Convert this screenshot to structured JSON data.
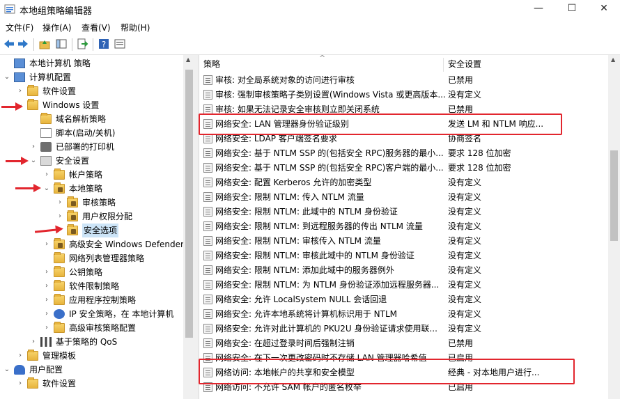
{
  "window": {
    "title": "本地组策略编辑器",
    "minimize": "—",
    "maximize": "☐",
    "close": "✕"
  },
  "menu": [
    "文件(F)",
    "操作(A)",
    "查看(V)",
    "帮助(H)"
  ],
  "tree": [
    {
      "label": "本地计算机 策略",
      "icon": "computer-policy-icon",
      "twisty": ""
    },
    {
      "label": "计算机配置",
      "icon": "computer-icon",
      "twisty": "⌄"
    },
    {
      "label": "软件设置",
      "icon": "folder-icon",
      "twisty": "›"
    },
    {
      "label": "Windows 设置",
      "icon": "folder-icon",
      "twisty": "⌄"
    },
    {
      "label": "域名解析策略",
      "icon": "folder-icon",
      "twisty": ""
    },
    {
      "label": "脚本(启动/关机)",
      "icon": "script-icon",
      "twisty": ""
    },
    {
      "label": "已部署的打印机",
      "icon": "printer-icon",
      "twisty": "›"
    },
    {
      "label": "安全设置",
      "icon": "security-icon",
      "twisty": "⌄"
    },
    {
      "label": "帐户策略",
      "icon": "folder-icon",
      "twisty": "›"
    },
    {
      "label": "本地策略",
      "icon": "lock-folder-icon",
      "twisty": "⌄"
    },
    {
      "label": "审核策略",
      "icon": "lock-folder-icon",
      "twisty": "›"
    },
    {
      "label": "用户权限分配",
      "icon": "lock-folder-icon",
      "twisty": "›"
    },
    {
      "label": "安全选项",
      "icon": "lock-folder-icon",
      "twisty": ""
    },
    {
      "label": "高级安全 Windows Defender",
      "icon": "lock-folder-icon",
      "twisty": "›"
    },
    {
      "label": "网络列表管理器策略",
      "icon": "folder-icon",
      "twisty": ""
    },
    {
      "label": "公钥策略",
      "icon": "folder-icon",
      "twisty": "›"
    },
    {
      "label": "软件限制策略",
      "icon": "folder-icon",
      "twisty": "›"
    },
    {
      "label": "应用程序控制策略",
      "icon": "folder-icon",
      "twisty": "›"
    },
    {
      "label": "IP 安全策略，在 本地计算机",
      "icon": "ip-security-icon",
      "twisty": "›"
    },
    {
      "label": "高级审核策略配置",
      "icon": "folder-icon",
      "twisty": "›"
    },
    {
      "label": "基于策略的 QoS",
      "icon": "qos-icon",
      "twisty": "›"
    },
    {
      "label": "管理模板",
      "icon": "folder-icon",
      "twisty": "›"
    },
    {
      "label": "用户配置",
      "icon": "user-icon",
      "twisty": "⌄"
    },
    {
      "label": "软件设置",
      "icon": "folder-icon",
      "twisty": "›"
    }
  ],
  "list": {
    "col_policy": "策略",
    "col_setting": "安全设置",
    "sort_glyph": "^",
    "rows": [
      {
        "name": "审核: 对全局系统对象的访问进行审核",
        "value": "已禁用"
      },
      {
        "name": "审核: 强制审核策略子类别设置(Windows Vista 或更高版本...",
        "value": "没有定义"
      },
      {
        "name": "审核: 如果无法记录安全审核则立即关闭系统",
        "value": "已禁用"
      },
      {
        "name": "网络安全: LAN 管理器身份验证级别",
        "value": "发送 LM 和 NTLM 响应..."
      },
      {
        "name": "网络安全: LDAP 客户端签名要求",
        "value": "协商签名"
      },
      {
        "name": "网络安全: 基于 NTLM SSP 的(包括安全 RPC)服务器的最小...",
        "value": "要求 128 位加密"
      },
      {
        "name": "网络安全: 基于 NTLM SSP 的(包括安全 RPC)客户端的最小...",
        "value": "要求 128 位加密"
      },
      {
        "name": "网络安全: 配置 Kerberos 允许的加密类型",
        "value": "没有定义"
      },
      {
        "name": "网络安全: 限制 NTLM: 传入 NTLM 流量",
        "value": "没有定义"
      },
      {
        "name": "网络安全: 限制 NTLM: 此域中的 NTLM 身份验证",
        "value": "没有定义"
      },
      {
        "name": "网络安全: 限制 NTLM: 到远程服务器的传出 NTLM 流量",
        "value": "没有定义"
      },
      {
        "name": "网络安全: 限制 NTLM: 审核传入 NTLM 流量",
        "value": "没有定义"
      },
      {
        "name": "网络安全: 限制 NTLM: 审核此域中的 NTLM 身份验证",
        "value": "没有定义"
      },
      {
        "name": "网络安全: 限制 NTLM: 添加此域中的服务器例外",
        "value": "没有定义"
      },
      {
        "name": "网络安全: 限制 NTLM: 为 NTLM 身份验证添加远程服务器...",
        "value": "没有定义"
      },
      {
        "name": "网络安全: 允许 LocalSystem NULL 会话回退",
        "value": "没有定义"
      },
      {
        "name": "网络安全: 允许本地系统将计算机标识用于 NTLM",
        "value": "没有定义"
      },
      {
        "name": "网络安全: 允许对此计算机的 PKU2U 身份验证请求使用联...",
        "value": "没有定义"
      },
      {
        "name": "网络安全: 在超过登录时间后强制注销",
        "value": "已禁用"
      },
      {
        "name": "网络安全: 在下一次更改密码时不存储 LAN 管理器哈希值",
        "value": "已启用"
      },
      {
        "name": "网络访问: 本地帐户的共享和安全模型",
        "value": "经典 - 对本地用户进行..."
      },
      {
        "name": "网络访问: 不允许 SAM 帐户的匿名枚举",
        "value": "已启用"
      }
    ]
  },
  "colors": {
    "highlight": "#e2262e",
    "selection": "#cce4f7"
  }
}
